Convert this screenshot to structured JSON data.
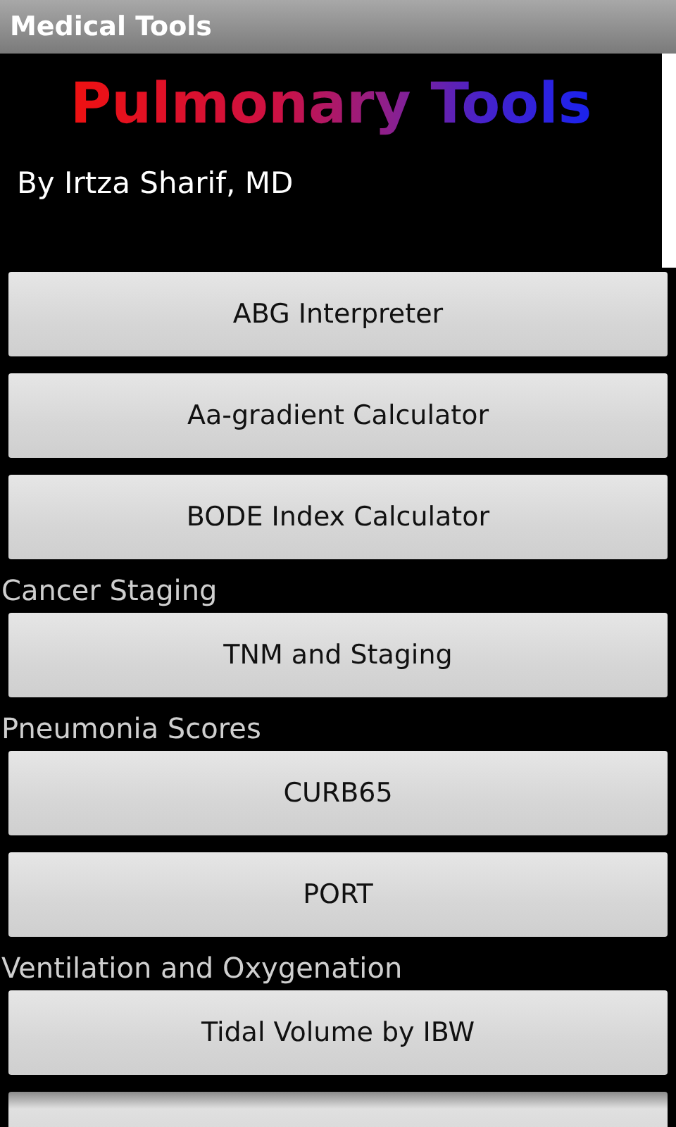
{
  "window": {
    "title": "Medical Tools"
  },
  "header": {
    "logo": "Pulmonary Tools",
    "byline": "By Irtza Sharif, MD"
  },
  "items": [
    {
      "kind": "button",
      "label": "ABG Interpreter"
    },
    {
      "kind": "button",
      "label": "Aa-gradient Calculator"
    },
    {
      "kind": "button",
      "label": "BODE Index Calculator"
    },
    {
      "kind": "heading",
      "label": "Cancer Staging"
    },
    {
      "kind": "button",
      "label": "TNM and Staging"
    },
    {
      "kind": "heading",
      "label": "Pneumonia Scores"
    },
    {
      "kind": "button",
      "label": "CURB65"
    },
    {
      "kind": "button",
      "label": "PORT"
    },
    {
      "kind": "heading",
      "label": "Ventilation and Oxygenation"
    },
    {
      "kind": "button",
      "label": "Tidal Volume by IBW"
    }
  ]
}
